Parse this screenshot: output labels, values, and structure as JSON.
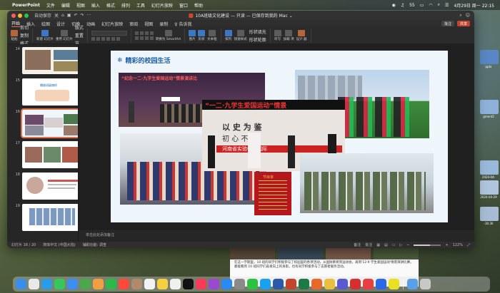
{
  "menubar": {
    "app_name": "PowerPoint",
    "items": [
      "文件",
      "编辑",
      "视图",
      "插入",
      "格式",
      "排列",
      "工具",
      "幻灯片放映",
      "窗口",
      "帮助"
    ],
    "battery": "55",
    "datetime": "4月29日 周一 22:15"
  },
  "window": {
    "autosave": "自动保存",
    "autosave_state": "关",
    "doc_title": "10A班级文化建设 — 只读 — 已保存到我的 Mac ⌄"
  },
  "ribbon": {
    "tabs": [
      "开始",
      "插入",
      "绘图",
      "设计",
      "切换",
      "动画",
      "幻灯片放映",
      "审阅",
      "视图",
      "录制",
      "♀ 告诉我"
    ],
    "active_tab": "开始",
    "comment_label": "批注",
    "share_label": "共享",
    "buttons": {
      "paste": "粘贴",
      "cut": "剪切",
      "copy": "复制",
      "format": "格式",
      "new_slide": "新建\n幻灯片",
      "reuse": "重用\n幻灯片",
      "layout": "版式",
      "reset": "重置",
      "section": "节",
      "smartart": "转换为\nSmartArt",
      "picture": "图片",
      "shape": "形状",
      "textbox": "文本框",
      "arrange": "排列",
      "quick_styles": "快速样式",
      "shape_fill": "形状填充",
      "shape_outline": "形状轮廓",
      "dictate": "听写",
      "addins": "加载\n项",
      "designer": "设计\n器"
    }
  },
  "thumbnails": [
    {
      "num": "14",
      "active": false
    },
    {
      "num": "15",
      "active": false,
      "caption": "播放班级旗帜"
    },
    {
      "num": "16",
      "active": true
    },
    {
      "num": "17",
      "active": false
    },
    {
      "num": "18",
      "active": false
    },
    {
      "num": "19",
      "active": false
    }
  ],
  "slide": {
    "title": "精彩的校园生活",
    "banner_text": "“纪念一二·九学生爱国运动”情景演讲比",
    "main_heading": "“一二·九学生爱国运动”情景",
    "stage_line1": "以  史  为  鉴",
    "stage_line2": "初  心  不  忘",
    "stage_banner": "河南省实验中学国际",
    "program_title": "节目单"
  },
  "notes": {
    "placeholder": "单击此处添加备注"
  },
  "statusbar": {
    "slide_info": "幻灯片 16 / 20",
    "language": "简体中文 (中国大陆)",
    "accessibility": "辅助功能: 调查",
    "notes_label": "备注",
    "comments_label": "批注",
    "zoom": "122%",
    "zoom_fraction": 0.6
  },
  "desktop": {
    "files": [
      "-6-2",
      "pptx",
      "gment2",
      "2024-04-",
      "2024-04-29",
      "-30.30"
    ]
  },
  "background_doc": {
    "text": "在这一学期里，10 班的同学们积极参与了校园里的各项活动，从国防教育到运动会，再到'12·9 学生爱国运动'情景演讲比赛，都能看到 10 班同学们奋发向上的身影。也有同学积极参与了志愿者服务活动。"
  },
  "dock": {
    "apps": [
      "finder",
      "launchpad",
      "safari",
      "messages",
      "mail",
      "maps",
      "photos",
      "facetime",
      "calendar",
      "contacts",
      "reminders",
      "notes",
      "freeform",
      "tv",
      "music",
      "podcasts",
      "app-store",
      "settings",
      "wechat",
      "qq",
      "word",
      "powerpoint",
      "excel",
      "browser",
      "chrome",
      "teams",
      "wps",
      "youdao",
      "baidu",
      "video",
      "downloads",
      "trash"
    ]
  },
  "colors": {
    "accent": "#e07050",
    "share": "#c4452c",
    "slide_title": "#1c5fa6",
    "window_bg": "#2b2b2b"
  }
}
